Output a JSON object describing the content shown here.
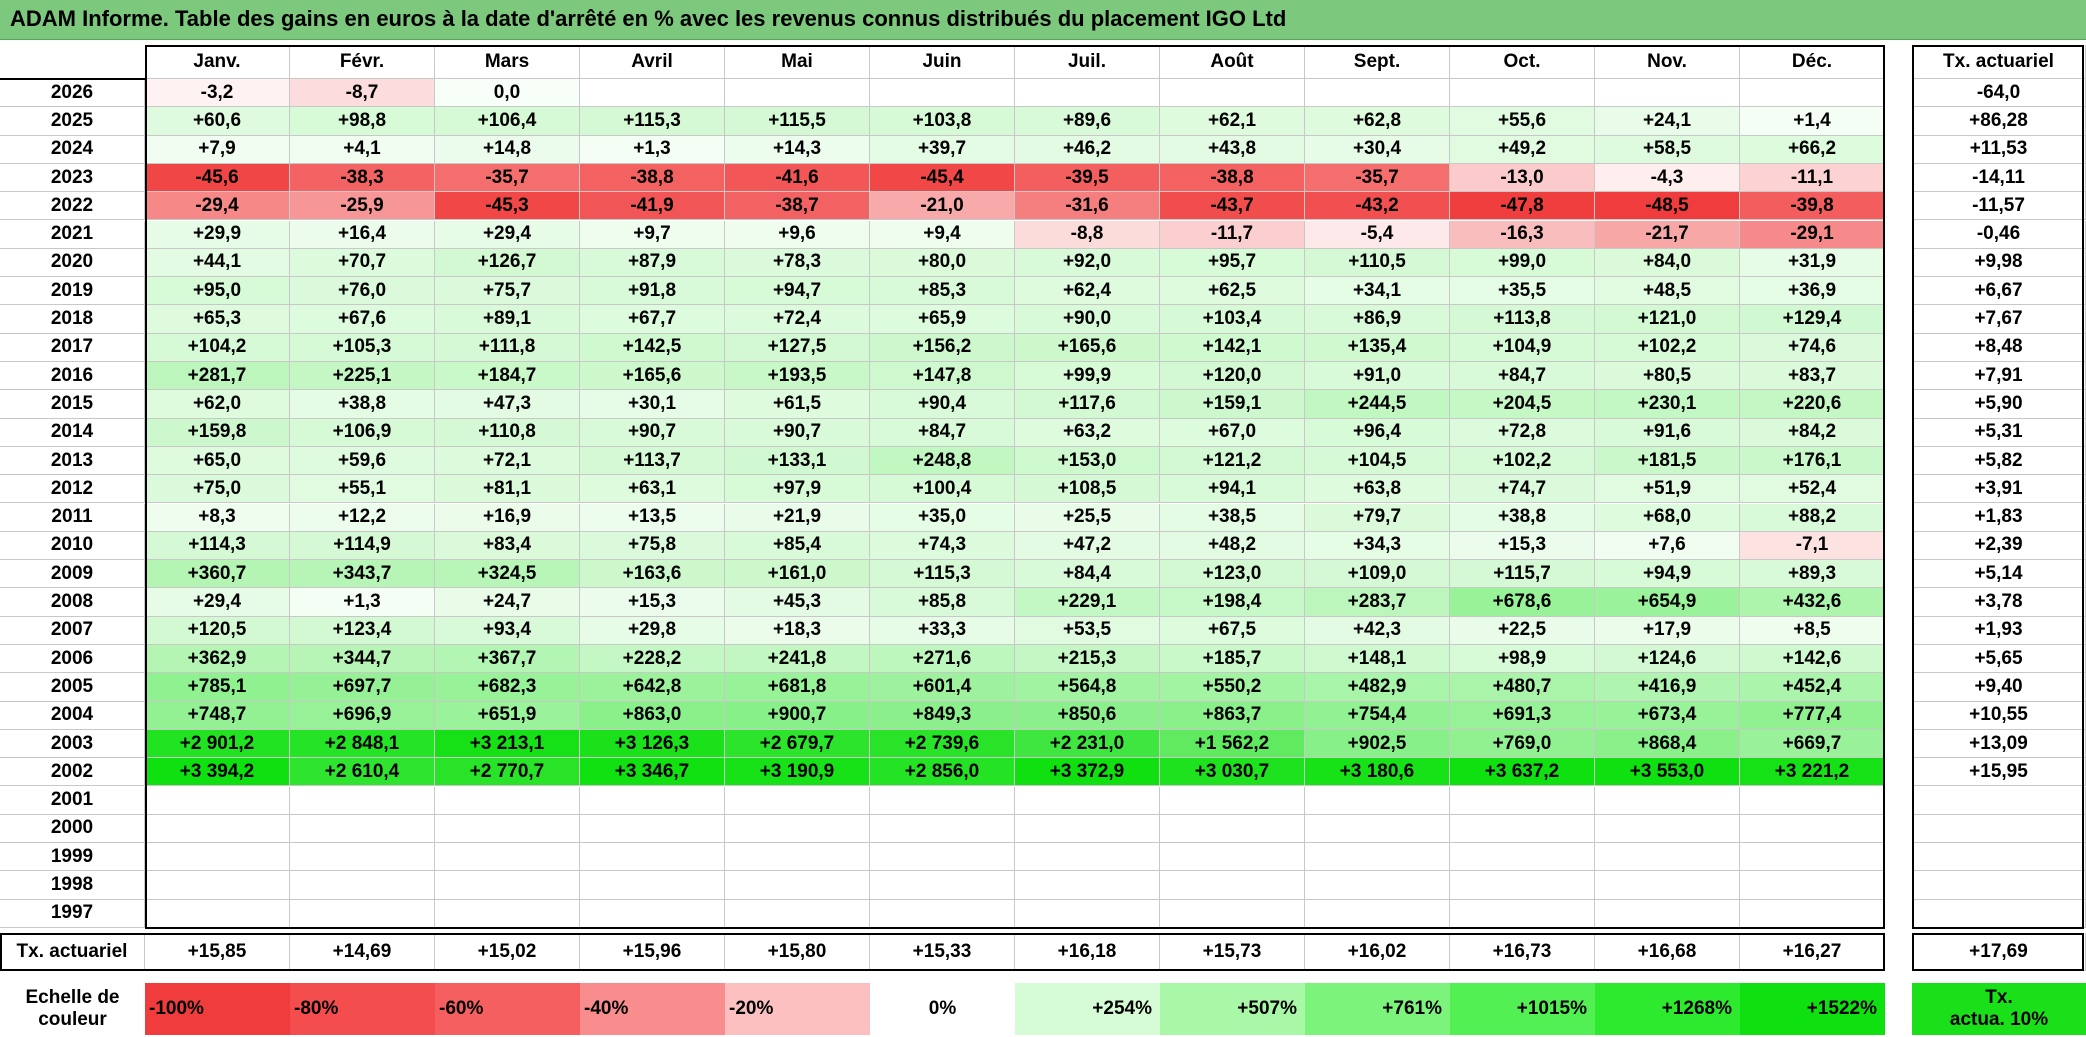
{
  "title": "ADAM Informe. Table des gains en euros à la date d'arrêté en % avec les revenus connus distribués du placement IGO Ltd",
  "months": [
    "Janv.",
    "Févr.",
    "Mars",
    "Avril",
    "Mai",
    "Juin",
    "Juil.",
    "Août",
    "Sept.",
    "Oct.",
    "Nov.",
    "Déc."
  ],
  "tx_header": "Tx. actuariel",
  "rows": [
    {
      "year": "2026",
      "values": [
        "-3,2",
        "-8,7",
        "0,0",
        "",
        "",
        "",
        "",
        "",
        "",
        "",
        "",
        ""
      ],
      "tx": "-64,0"
    },
    {
      "year": "2025",
      "values": [
        "+60,6",
        "+98,8",
        "+106,4",
        "+115,3",
        "+115,5",
        "+103,8",
        "+89,6",
        "+62,1",
        "+62,8",
        "+55,6",
        "+24,1",
        "+1,4"
      ],
      "tx": "+86,28"
    },
    {
      "year": "2024",
      "values": [
        "+7,9",
        "+4,1",
        "+14,8",
        "+1,3",
        "+14,3",
        "+39,7",
        "+46,2",
        "+43,8",
        "+30,4",
        "+49,2",
        "+58,5",
        "+66,2"
      ],
      "tx": "+11,53"
    },
    {
      "year": "2023",
      "values": [
        "-45,6",
        "-38,3",
        "-35,7",
        "-38,8",
        "-41,6",
        "-45,4",
        "-39,5",
        "-38,8",
        "-35,7",
        "-13,0",
        "-4,3",
        "-11,1"
      ],
      "tx": "-14,11"
    },
    {
      "year": "2022",
      "values": [
        "-29,4",
        "-25,9",
        "-45,3",
        "-41,9",
        "-38,7",
        "-21,0",
        "-31,6",
        "-43,7",
        "-43,2",
        "-47,8",
        "-48,5",
        "-39,8"
      ],
      "tx": "-11,57"
    },
    {
      "year": "2021",
      "values": [
        "+29,9",
        "+16,4",
        "+29,4",
        "+9,7",
        "+9,6",
        "+9,4",
        "-8,8",
        "-11,7",
        "-5,4",
        "-16,3",
        "-21,7",
        "-29,1"
      ],
      "tx": "-0,46"
    },
    {
      "year": "2020",
      "values": [
        "+44,1",
        "+70,7",
        "+126,7",
        "+87,9",
        "+78,3",
        "+80,0",
        "+92,0",
        "+95,7",
        "+110,5",
        "+99,0",
        "+84,0",
        "+31,9"
      ],
      "tx": "+9,98"
    },
    {
      "year": "2019",
      "values": [
        "+95,0",
        "+76,0",
        "+75,7",
        "+91,8",
        "+94,7",
        "+85,3",
        "+62,4",
        "+62,5",
        "+34,1",
        "+35,5",
        "+48,5",
        "+36,9"
      ],
      "tx": "+6,67"
    },
    {
      "year": "2018",
      "values": [
        "+65,3",
        "+67,6",
        "+89,1",
        "+67,7",
        "+72,4",
        "+65,9",
        "+90,0",
        "+103,4",
        "+86,9",
        "+113,8",
        "+121,0",
        "+129,4"
      ],
      "tx": "+7,67"
    },
    {
      "year": "2017",
      "values": [
        "+104,2",
        "+105,3",
        "+111,8",
        "+142,5",
        "+127,5",
        "+156,2",
        "+165,6",
        "+142,1",
        "+135,4",
        "+104,9",
        "+102,2",
        "+74,6"
      ],
      "tx": "+8,48"
    },
    {
      "year": "2016",
      "values": [
        "+281,7",
        "+225,1",
        "+184,7",
        "+165,6",
        "+193,5",
        "+147,8",
        "+99,9",
        "+120,0",
        "+91,0",
        "+84,7",
        "+80,5",
        "+83,7"
      ],
      "tx": "+7,91"
    },
    {
      "year": "2015",
      "values": [
        "+62,0",
        "+38,8",
        "+47,3",
        "+30,1",
        "+61,5",
        "+90,4",
        "+117,6",
        "+159,1",
        "+244,5",
        "+204,5",
        "+230,1",
        "+220,6"
      ],
      "tx": "+5,90"
    },
    {
      "year": "2014",
      "values": [
        "+159,8",
        "+106,9",
        "+110,8",
        "+90,7",
        "+90,7",
        "+84,7",
        "+63,2",
        "+67,0",
        "+96,4",
        "+72,8",
        "+91,6",
        "+84,2"
      ],
      "tx": "+5,31"
    },
    {
      "year": "2013",
      "values": [
        "+65,0",
        "+59,6",
        "+72,1",
        "+113,7",
        "+133,1",
        "+248,8",
        "+153,0",
        "+121,2",
        "+104,5",
        "+102,2",
        "+181,5",
        "+176,1"
      ],
      "tx": "+5,82"
    },
    {
      "year": "2012",
      "values": [
        "+75,0",
        "+55,1",
        "+81,1",
        "+63,1",
        "+97,9",
        "+100,4",
        "+108,5",
        "+94,1",
        "+63,8",
        "+74,7",
        "+51,9",
        "+52,4"
      ],
      "tx": "+3,91"
    },
    {
      "year": "2011",
      "values": [
        "+8,3",
        "+12,2",
        "+16,9",
        "+13,5",
        "+21,9",
        "+35,0",
        "+25,5",
        "+38,5",
        "+79,7",
        "+38,8",
        "+68,0",
        "+88,2"
      ],
      "tx": "+1,83"
    },
    {
      "year": "2010",
      "values": [
        "+114,3",
        "+114,9",
        "+83,4",
        "+75,8",
        "+85,4",
        "+74,3",
        "+47,2",
        "+48,2",
        "+34,3",
        "+15,3",
        "+7,6",
        "-7,1"
      ],
      "tx": "+2,39"
    },
    {
      "year": "2009",
      "values": [
        "+360,7",
        "+343,7",
        "+324,5",
        "+163,6",
        "+161,0",
        "+115,3",
        "+84,4",
        "+123,0",
        "+109,0",
        "+115,7",
        "+94,9",
        "+89,3"
      ],
      "tx": "+5,14"
    },
    {
      "year": "2008",
      "values": [
        "+29,4",
        "+1,3",
        "+24,7",
        "+15,3",
        "+45,3",
        "+85,8",
        "+229,1",
        "+198,4",
        "+283,7",
        "+678,6",
        "+654,9",
        "+432,6"
      ],
      "tx": "+3,78"
    },
    {
      "year": "2007",
      "values": [
        "+120,5",
        "+123,4",
        "+93,4",
        "+29,8",
        "+18,3",
        "+33,3",
        "+53,5",
        "+67,5",
        "+42,3",
        "+22,5",
        "+17,9",
        "+8,5"
      ],
      "tx": "+1,93"
    },
    {
      "year": "2006",
      "values": [
        "+362,9",
        "+344,7",
        "+367,7",
        "+228,2",
        "+241,8",
        "+271,6",
        "+215,3",
        "+185,7",
        "+148,1",
        "+98,9",
        "+124,6",
        "+142,6"
      ],
      "tx": "+5,65"
    },
    {
      "year": "2005",
      "values": [
        "+785,1",
        "+697,7",
        "+682,3",
        "+642,8",
        "+681,8",
        "+601,4",
        "+564,8",
        "+550,2",
        "+482,9",
        "+480,7",
        "+416,9",
        "+452,4"
      ],
      "tx": "+9,40"
    },
    {
      "year": "2004",
      "values": [
        "+748,7",
        "+696,9",
        "+651,9",
        "+863,0",
        "+900,7",
        "+849,3",
        "+850,6",
        "+863,7",
        "+754,4",
        "+691,3",
        "+673,4",
        "+777,4"
      ],
      "tx": "+10,55"
    },
    {
      "year": "2003",
      "values": [
        "+2 901,2",
        "+2 848,1",
        "+3 213,1",
        "+3 126,3",
        "+2 679,7",
        "+2 739,6",
        "+2 231,0",
        "+1 562,2",
        "+902,5",
        "+769,0",
        "+868,4",
        "+669,7"
      ],
      "tx": "+13,09"
    },
    {
      "year": "2002",
      "values": [
        "+3 394,2",
        "+2 610,4",
        "+2 770,7",
        "+3 346,7",
        "+3 190,9",
        "+2 856,0",
        "+3 372,9",
        "+3 030,7",
        "+3 180,6",
        "+3 637,2",
        "+3 553,0",
        "+3 221,2"
      ],
      "tx": "+15,95"
    },
    {
      "year": "2001",
      "values": [
        "",
        "",
        "",
        "",
        "",
        "",
        "",
        "",
        "",
        "",
        "",
        ""
      ],
      "tx": ""
    },
    {
      "year": "2000",
      "values": [
        "",
        "",
        "",
        "",
        "",
        "",
        "",
        "",
        "",
        "",
        "",
        ""
      ],
      "tx": ""
    },
    {
      "year": "1999",
      "values": [
        "",
        "",
        "",
        "",
        "",
        "",
        "",
        "",
        "",
        "",
        "",
        ""
      ],
      "tx": ""
    },
    {
      "year": "1998",
      "values": [
        "",
        "",
        "",
        "",
        "",
        "",
        "",
        "",
        "",
        "",
        "",
        ""
      ],
      "tx": ""
    },
    {
      "year": "1997",
      "values": [
        "",
        "",
        "",
        "",
        "",
        "",
        "",
        "",
        "",
        "",
        "",
        ""
      ],
      "tx": ""
    }
  ],
  "footer": {
    "label": "Tx. actuariel",
    "values": [
      "+15,85",
      "+14,69",
      "+15,02",
      "+15,96",
      "+15,80",
      "+15,33",
      "+16,18",
      "+15,73",
      "+16,02",
      "+16,73",
      "+16,68",
      "+16,27"
    ],
    "tx": "+17,69"
  },
  "scale": {
    "label_line1": "Echelle de",
    "label_line2": "couleur",
    "steps": [
      {
        "text": "-100%",
        "color": "#f03c3c"
      },
      {
        "text": "-80%",
        "color": "#f34d4d"
      },
      {
        "text": "-60%",
        "color": "#f65f5f"
      },
      {
        "text": "-40%",
        "color": "#f98c8c"
      },
      {
        "text": "-20%",
        "color": "#fcc0c0"
      },
      {
        "text": "0%",
        "color": "#ffffff"
      },
      {
        "text": "+254%",
        "color": "#d6fcd6"
      },
      {
        "text": "+507%",
        "color": "#a8f8a8"
      },
      {
        "text": "+761%",
        "color": "#7cf47c"
      },
      {
        "text": "+1015%",
        "color": "#52f052"
      },
      {
        "text": "+1268%",
        "color": "#2eea2e"
      },
      {
        "text": "+1522%",
        "color": "#0fe00f"
      }
    ],
    "tx_line1": "Tx.",
    "tx_line2": "actua. 10%",
    "tx_color": "#19e019"
  },
  "colors": {
    "title_bg": "#7cc87c",
    "neg_max": "#f03c3c",
    "pos_max": "#0fe00f"
  }
}
